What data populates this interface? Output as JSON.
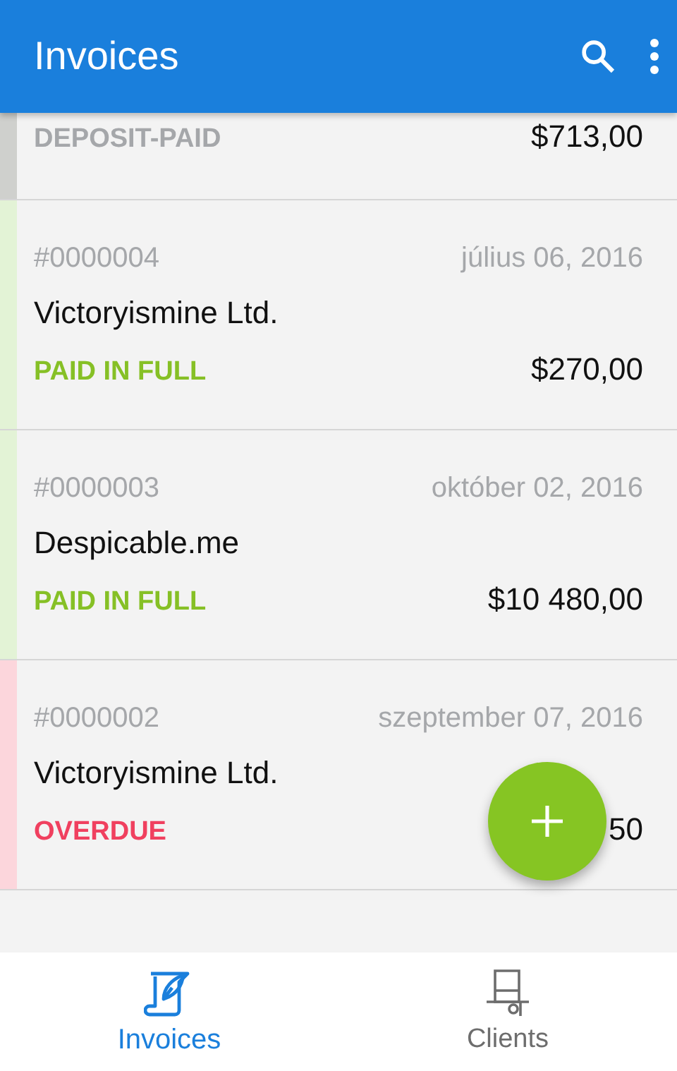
{
  "app_bar": {
    "title": "Invoices"
  },
  "invoices": [
    {
      "status": "DEPOSIT-PAID",
      "kind": "deposit",
      "amount": "$713,00",
      "color": "#cfd0cd"
    },
    {
      "number": "#0000004",
      "date": "július 06, 2016",
      "client": "Victoryismine Ltd.",
      "status": "PAID IN FULL",
      "kind": "paid",
      "amount": "$270,00",
      "color": "#e3f3d6"
    },
    {
      "number": "#0000003",
      "date": "október 02, 2016",
      "client": "Despicable.me",
      "status": "PAID IN FULL",
      "kind": "paid",
      "amount": "$10 480,00",
      "color": "#e3f3d6"
    },
    {
      "number": "#0000002",
      "date": "szeptember 07, 2016",
      "client": "Victoryismine Ltd.",
      "status": "OVERDUE",
      "kind": "overdue",
      "amount": "50",
      "color": "#fcd6dc"
    }
  ],
  "bottom_nav": [
    {
      "label": "Invoices",
      "selected": true
    },
    {
      "label": "Clients",
      "selected": false
    }
  ]
}
